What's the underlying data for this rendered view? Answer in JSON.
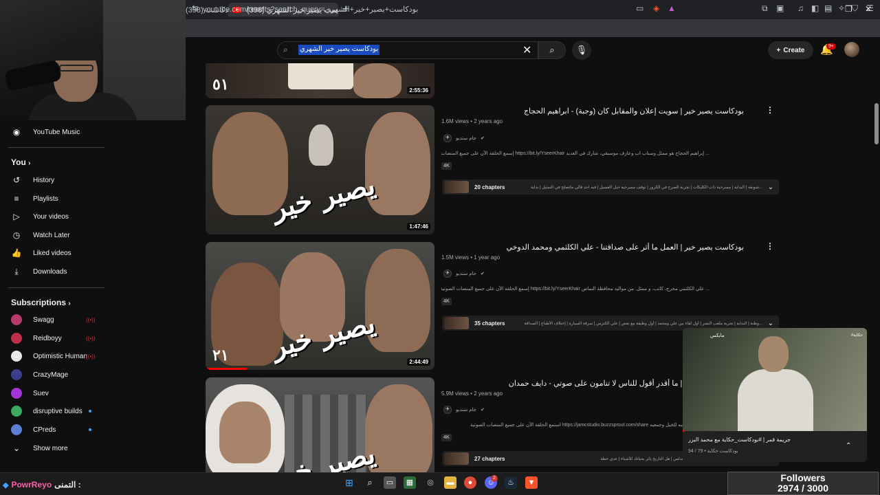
{
  "browser": {
    "tab_prev_label": "(398) بودكاست",
    "tab_active_label": "(398) بودكاست يصير خير الشهري",
    "url": "youtube.com/results?search_query=بودكاست+يصير+خير+الشهري"
  },
  "sidebar": {
    "music_label": "YouTube Music",
    "you_heading": "You",
    "you_items": [
      {
        "label": "History",
        "icon": "history-icon"
      },
      {
        "label": "Playlists",
        "icon": "playlists-icon"
      },
      {
        "label": "Your videos",
        "icon": "your-videos-icon"
      },
      {
        "label": "Watch Later",
        "icon": "watch-later-icon"
      },
      {
        "label": "Liked videos",
        "icon": "liked-icon"
      },
      {
        "label": "Downloads",
        "icon": "downloads-icon"
      }
    ],
    "subs_heading": "Subscriptions",
    "subscriptions": [
      {
        "label": "Swagg",
        "status": "live"
      },
      {
        "label": "Reidboyy",
        "status": "live"
      },
      {
        "label": "Optimistic Human",
        "status": "live"
      },
      {
        "label": "CrazyMage",
        "status": ""
      },
      {
        "label": "Suev",
        "status": ""
      },
      {
        "label": "disruptive builds",
        "status": "new"
      },
      {
        "label": "CPreds",
        "status": "new"
      }
    ],
    "show_more": "Show more"
  },
  "header": {
    "search_query": "بودكاست يصير خير الشهري",
    "create_label": "Create",
    "notif_count": "9+"
  },
  "top_partial": {
    "number": "٥١",
    "duration": "2:55:36"
  },
  "videos": [
    {
      "title": "بودكاست يصير خير | سويت إعلان والمقابل كان (وجبة) - ابراهيم الحجاج",
      "meta": "1.6M views • 2 years ago",
      "channel": "جام ستديو",
      "description": "... إبراهيم الحجاج هو ممثل وسناب اب وعازف موسيقي، شارك في العديد https://bit.ly/YseerKhair إسمع الحلقة الآن على جميع المنصات الصوتية",
      "badge": "4K",
      "chapters_count": "20 chapters",
      "chapters_list": "...شوبقة | البداية | مسرحية ذات الكليكات | تجربة الصرح في الكروز | توقف مسرحية حبل الغسيل | فيه احد قالي ماتصلح في التمثيل | بداية",
      "duration": "1:47:46",
      "episode": ""
    },
    {
      "title": "بودكاست يصير خير | العمل ما أثر على صداقتنا - علي الكلثمي ومحمد الدوخي",
      "meta": "1.5M views • 1 year ago",
      "channel": "جام ستديو",
      "description": "... علي الكلثمي مخرج، كاتب، و ممثل. من مواليد محافظة النماص https://bit.ly/YseerKhair إسمع الحلقة الآن على جميع المنصات الصوتية",
      "badge": "4K",
      "chapters_count": "35 chapters",
      "chapters_list": "...وطنة | البداية | تجربة ملعب النصر | أول لقاء بين علي ومحمد | أول وظيفة مع بعض | علي الكترس | سرقة السيارة | إختلاف الأطباع | الصداقة",
      "duration": "2:44:49",
      "episode": "٢١"
    },
    {
      "title": "بودكاست يصير خير | ما أقدر أقول للناس لا تنامون على صوتي - دايف حمدان",
      "meta": "5.9M views • 2 years ago",
      "channel": "جام ستديو",
      "description": "... دايف عن حبه للخيل وجمعيه https://jamcstudio.buzzsprout.com/share استمع الحلقة الآن على جميع المنصات الصوتية",
      "badge": "4K",
      "chapters_count": "27 chapters",
      "chapters_list": "...الفريط | هل قصص دايف صحيحة | التاريخ والأندلس | هل التاريخ يأثر بحياتك للأشياء | عدي خطة",
      "duration": "",
      "episode": ""
    }
  ],
  "miniplayer": {
    "title": "جريمة قمر | #بودكاست_حكاية مع محمد البزر",
    "meta": "بودكاست حكاية • 79 / 94",
    "logo": "مابكس",
    "tag": "#حكاية"
  },
  "taskbar": {
    "overlay_label": "التمنى :",
    "overlay_name": "PowrReyo",
    "discord_badge": "2"
  },
  "followers": {
    "label": "Followers",
    "count": "2974 / 3000"
  },
  "colors": {
    "background": "#0f0f0f",
    "accent_red": "#ff0000",
    "selection_blue": "#1a4bbf"
  }
}
